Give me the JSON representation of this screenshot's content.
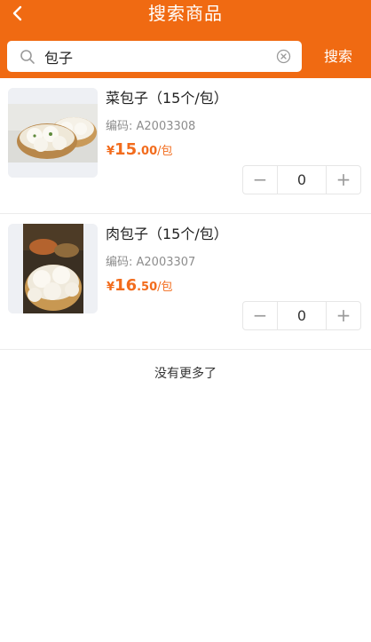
{
  "header": {
    "title": "搜索商品",
    "back_icon": "chevron-left-icon",
    "background": "#f06a12"
  },
  "search": {
    "value": "包子",
    "placeholder": "",
    "search_icon": "search-icon",
    "clear_icon": "clear-circle-icon",
    "button_label": "搜索"
  },
  "products": [
    {
      "name": "菜包子（15个/包）",
      "code": "编码: A2003308",
      "price_currency": "¥",
      "price_int": "15",
      "price_dec": ".00",
      "price_unit": "/包",
      "quantity": "0",
      "minus_label": "−",
      "plus_label": "+"
    },
    {
      "name": "肉包子（15个/包）",
      "code": "编码: A2003307",
      "price_currency": "¥",
      "price_int": "16",
      "price_dec": ".50",
      "price_unit": "/包",
      "quantity": "0",
      "minus_label": "−",
      "plus_label": "+"
    }
  ],
  "footer": {
    "no_more": "没有更多了"
  },
  "colors": {
    "accent": "#f06a12",
    "price": "#f26c1d"
  }
}
